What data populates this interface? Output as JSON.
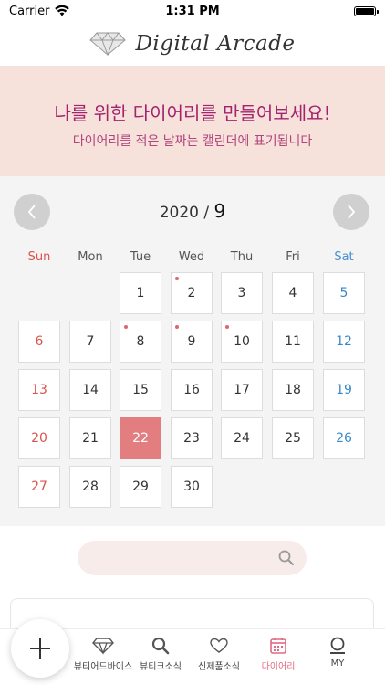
{
  "status": {
    "carrier": "Carrier",
    "time": "1:31 PM"
  },
  "header": {
    "title": "Digital Arcade"
  },
  "banner": {
    "title": "나를 위한 다이어리를 만들어보세요!",
    "subtitle": "다이어리를 적은 날짜는 캘린더에 표기됩니다"
  },
  "calendar": {
    "year": "2020",
    "separator": " / ",
    "month": "9",
    "prev_icon": "chevron-left-icon",
    "next_icon": "chevron-right-icon",
    "weekdays": [
      "Sun",
      "Mon",
      "Tue",
      "Wed",
      "Thu",
      "Fri",
      "Sat"
    ],
    "first_weekday": 2,
    "days_in_month": 30,
    "today": 22,
    "entry_days": [
      2,
      8,
      9,
      10
    ],
    "colors": {
      "sunday": "#d9534f",
      "saturday": "#3a87c8",
      "today": "#e37e80",
      "dot": "#e06666"
    }
  },
  "search": {
    "placeholder": "",
    "icon": "search-icon"
  },
  "tabs": [
    {
      "label": "",
      "icon": "plus-icon"
    },
    {
      "label": "뷰티어드바이스",
      "icon": "diamond-icon"
    },
    {
      "label": "뷰티크소식",
      "icon": "search-icon"
    },
    {
      "label": "신제품소식",
      "icon": "heart-icon"
    },
    {
      "label": "다이어리",
      "icon": "calendar-icon",
      "active": true
    },
    {
      "label": "MY",
      "icon": "user-icon"
    }
  ],
  "colors": {
    "accent": "#e06b80",
    "banner_bg": "#f6e2da",
    "banner_text": "#a4226e"
  }
}
